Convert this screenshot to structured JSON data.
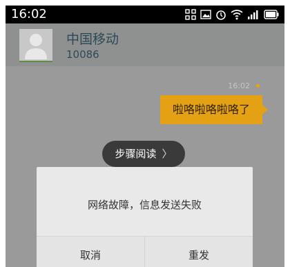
{
  "status_bar": {
    "time": "16:02",
    "icons": [
      "app-grid-icon",
      "image-icon",
      "alarm-icon",
      "wifi-icon",
      "signal-icon",
      "battery-icon"
    ]
  },
  "conversation": {
    "contact_name": "中国移动",
    "contact_number": "10086"
  },
  "message": {
    "time": "16:02",
    "text": "啦咯啦咯啦咯了",
    "bubble_color": "#e5a114",
    "status_dot_color": "#f2a500"
  },
  "step_read": {
    "label": "步骤阅读",
    "chevron": "〉"
  },
  "dialog": {
    "message": "网络故障，信息发送失败",
    "cancel_label": "取消",
    "resend_label": "重发"
  }
}
